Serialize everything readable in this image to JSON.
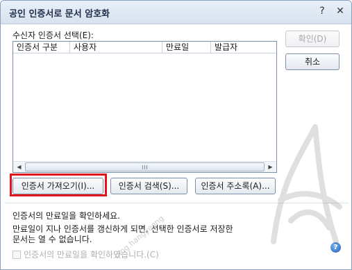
{
  "window": {
    "title": "공인 인증서로 문서 암호화",
    "help_glyph": "?",
    "close_glyph": "✕"
  },
  "recipient": {
    "label": "수신자 인증서 선택(E):",
    "columns": [
      "인증서 구분",
      "사용자",
      "만료일",
      "발급자"
    ],
    "rows": []
  },
  "buttons": {
    "ok": "확인(D)",
    "cancel": "취소",
    "import": "인증서 가져오기(I)...",
    "search": "인증서 검색(S)...",
    "address_book": "인증서 주소록(A)..."
  },
  "messages": {
    "check_expiry": "인증서의 만료일을 확인하세요.",
    "warning_line1": "만료일이 지나 인증서를 갱신하게 되면, 선택한 인증서로 저장한",
    "warning_line2": "문서는 열 수 없습니다."
  },
  "checkbox": {
    "label": "인증서의 만료일을 확인하였습니다.(C)",
    "checked": false
  },
  "watermark": {
    "text": "blog.hangyeong"
  },
  "icons": {
    "scroll_left": "left-arrow-icon",
    "scroll_right": "right-arrow-icon",
    "help": "help-icon"
  },
  "colors": {
    "highlight": "#e0141c",
    "title_bg": "#dfe8f3",
    "disabled_text": "#a8a8a8"
  }
}
